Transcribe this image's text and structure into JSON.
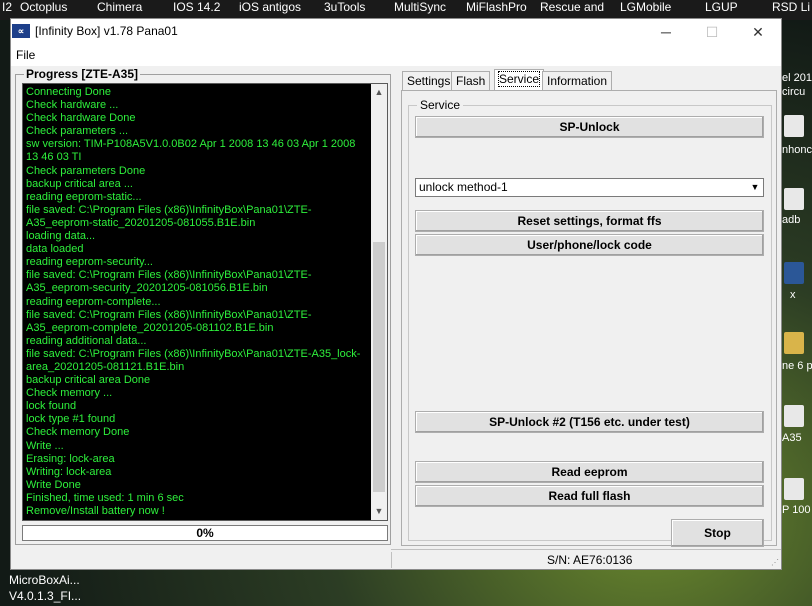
{
  "desktop": {
    "taskbar_items": [
      "I2",
      "Octoplus",
      "Chimera",
      "IOS 14.2",
      "iOS antigos",
      "3uTools",
      "MultiSync",
      "MiFlashPro",
      "Rescue and",
      "LGMobile",
      "LGUP",
      "RSD Li"
    ],
    "right_labels": [
      "el 201",
      "circu",
      "nhonc",
      "adb",
      "x",
      "ne 6 p",
      "A35",
      "P 100"
    ],
    "bottom_left_line1": "MicroBoxAi...",
    "bottom_left_line2": "V4.0.1.3_FI..."
  },
  "window": {
    "title": "[Infinity Box] v1.78 Pana01",
    "icon_text": "∝",
    "menu": {
      "file": "File"
    },
    "controls": {
      "minimize": "─",
      "maximize": "☐",
      "close": "✕"
    }
  },
  "progress": {
    "group_label": "Progress [ZTE-A35]",
    "percent_text": "0%",
    "percent_value": 0,
    "log_lines": [
      "Connecting Done",
      "Check hardware ...",
      "Check hardware Done",
      "Check parameters ...",
      "sw version: TIM-P108A5V1.0.0B02 Apr  1 2008 13 46 03 Apr  1 2008",
      "13 46 03 TI",
      "Check parameters Done",
      "backup critical area ...",
      "reading eeprom-static...",
      "file saved: C:\\Program Files (x86)\\InfinityBox\\Pana01\\ZTE-",
      "A35_eeprom-static_20201205-081055.B1E.bin",
      "loading data...",
      "data loaded",
      "reading eeprom-security...",
      "file saved: C:\\Program Files (x86)\\InfinityBox\\Pana01\\ZTE-",
      "A35_eeprom-security_20201205-081056.B1E.bin",
      "reading eeprom-complete...",
      "file saved: C:\\Program Files (x86)\\InfinityBox\\Pana01\\ZTE-",
      "A35_eeprom-complete_20201205-081102.B1E.bin",
      "reading additional data...",
      "file saved: C:\\Program Files (x86)\\InfinityBox\\Pana01\\ZTE-A35_lock-",
      "area_20201205-081121.B1E.bin",
      "backup critical area Done",
      "Check memory ...",
      "lock found",
      "lock type #1 found",
      "Check memory Done",
      "Write ...",
      "Erasing: lock-area",
      "Writing: lock-area",
      "Write Done",
      "Finished, time used: 1 min 6 sec",
      "Remove/Install battery now !"
    ]
  },
  "tabs": [
    "Settings",
    "Flash",
    "Service",
    "Information"
  ],
  "active_tab": "Service",
  "service": {
    "group_label": "Service",
    "sp_unlock": "SP-Unlock",
    "method_select": "unlock method-1",
    "reset_settings": "Reset settings, format ffs",
    "user_phone_lock": "User/phone/lock code",
    "sp_unlock_2": "SP-Unlock #2 (T156 etc. under test)",
    "read_eeprom": "Read eeprom",
    "read_full_flash": "Read full flash",
    "stop": "Stop"
  },
  "status": {
    "serial": "S/N: AE76:0136"
  },
  "colors": {
    "log_text": "#2ef03c",
    "log_bg": "#000000",
    "progress_fill": "#06b025"
  }
}
